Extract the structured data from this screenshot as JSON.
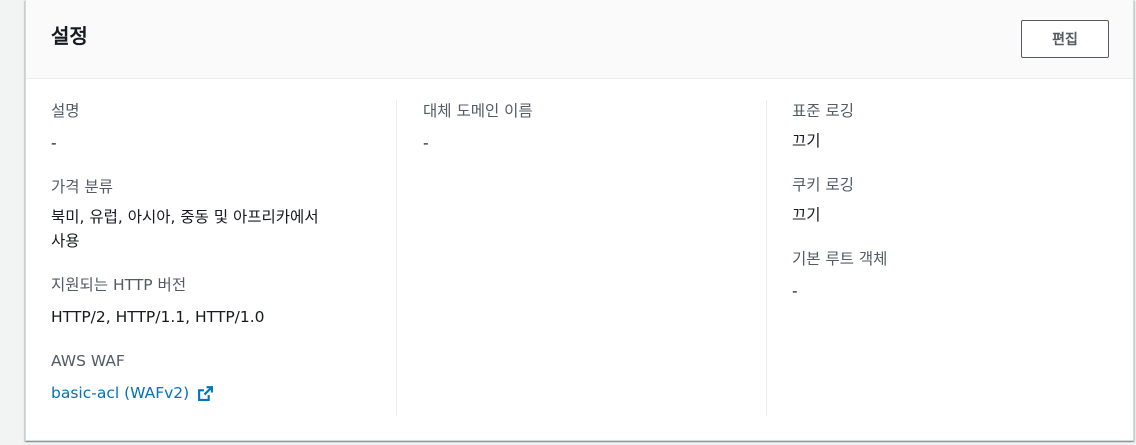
{
  "panel": {
    "title": "설정",
    "edit_label": "편집"
  },
  "columns": {
    "col1": {
      "description": {
        "label": "설명",
        "value": "-"
      },
      "price_class": {
        "label": "가격 분류",
        "value_line1": "북미, 유럽, 아시아, 중동 및 아프리카에서",
        "value_line2": "사용"
      },
      "http_versions": {
        "label": "지원되는 HTTP 버전",
        "value": "HTTP/2, HTTP/1.1, HTTP/1.0"
      },
      "waf": {
        "label": "AWS WAF",
        "link_text": "basic-acl (WAFv2)",
        "icon": "external-link-icon"
      }
    },
    "col2": {
      "alternate_domain": {
        "label": "대체 도메인 이름",
        "value": "-"
      }
    },
    "col3": {
      "standard_logging": {
        "label": "표준 로깅",
        "value": "끄기"
      },
      "cookie_logging": {
        "label": "쿠키 로깅",
        "value": "끄기"
      },
      "default_root_object": {
        "label": "기본 루트 객체",
        "value": "-"
      }
    }
  },
  "colors": {
    "link": "#0073bb",
    "label": "#545b64",
    "text": "#16191f"
  }
}
